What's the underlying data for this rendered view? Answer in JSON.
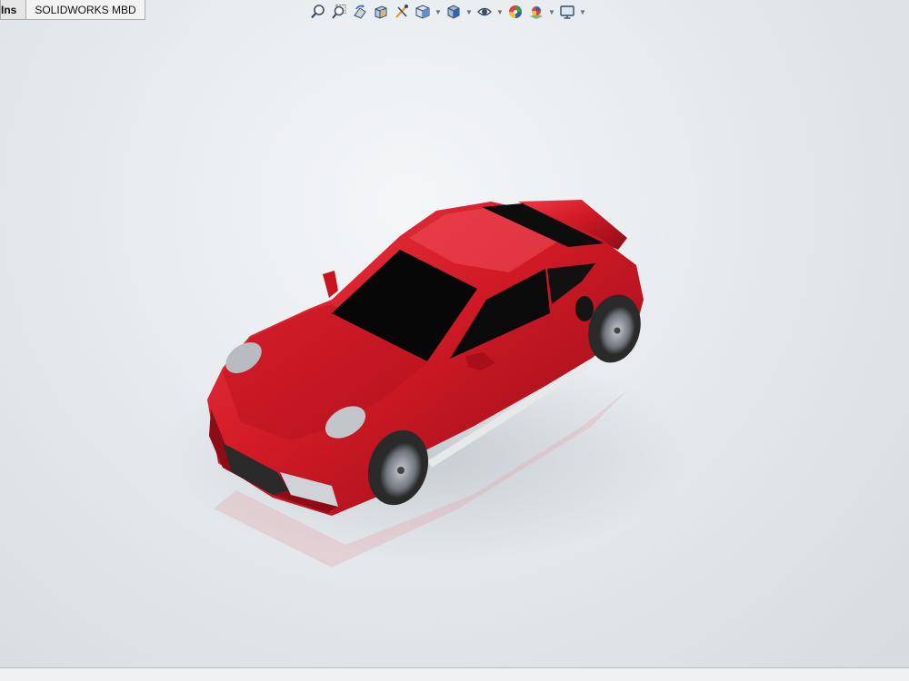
{
  "tabs": [
    {
      "label": "Ins"
    },
    {
      "label": "SOLIDWORKS MBD"
    }
  ],
  "heads_up_toolbar": {
    "icons": [
      "zoom-to-fit-icon",
      "zoom-to-area-icon",
      "previous-view-icon",
      "section-view-icon",
      "dynamic-annotation-views-icon",
      "view-orientation-icon",
      "display-style-icon",
      "hide-show-items-icon",
      "edit-appearance-icon",
      "apply-scene-icon",
      "view-settings-icon"
    ]
  },
  "model": {
    "body_color": "#d11a26",
    "glass_color": "#0a0a0a",
    "tire_color": "#2b2b2b",
    "rim_color": "#9ea3a8"
  }
}
